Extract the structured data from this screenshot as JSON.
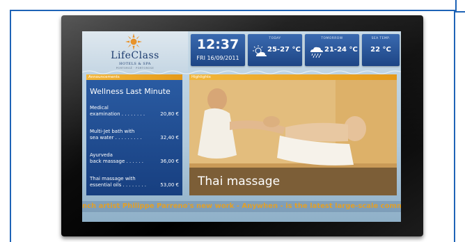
{
  "brand": {
    "name": "LifeClass",
    "subtitle": "HOTELS & SPA",
    "location": "PORTOROŽ · PORTOROSE"
  },
  "clock": {
    "time": "12:37",
    "date": "FRI 16/09/2011"
  },
  "weather": {
    "today": {
      "label": "TODAY",
      "temp": "25-27 °C",
      "icon": "sun-cloud-icon"
    },
    "tomorrow": {
      "label": "TOMORROW",
      "temp": "21-24 °C",
      "icon": "rain-cloud-icon"
    },
    "sea": {
      "label": "SEA TEMP.",
      "temp": "22 °C"
    }
  },
  "announcements": {
    "label": "Announcements",
    "title": "Wellness Last Minute",
    "items": [
      {
        "name_line1": "Medical",
        "name_line2": "examination",
        "price": "20,80 €"
      },
      {
        "name_line1": "Multi-Jet bath with",
        "name_line2": "sea water",
        "price": "32,40 €"
      },
      {
        "name_line1": "Ayurveda",
        "name_line2": "back massage",
        "price": "36,00 €"
      },
      {
        "name_line1": "Thai massage with",
        "name_line2": "essential oils",
        "price": "53,00 €"
      }
    ]
  },
  "highlights": {
    "label": "Highlights",
    "caption": "Thai massage"
  },
  "ticker": {
    "text": "nch artist Philippe Parreno's new work - Anywhen - is the latest large-scale commissi"
  },
  "colors": {
    "frame_border": "#1e63b6",
    "tile_blue": "#2a5ba2",
    "label_orange": "#e59a1a",
    "ticker_text": "#e0a02a"
  }
}
